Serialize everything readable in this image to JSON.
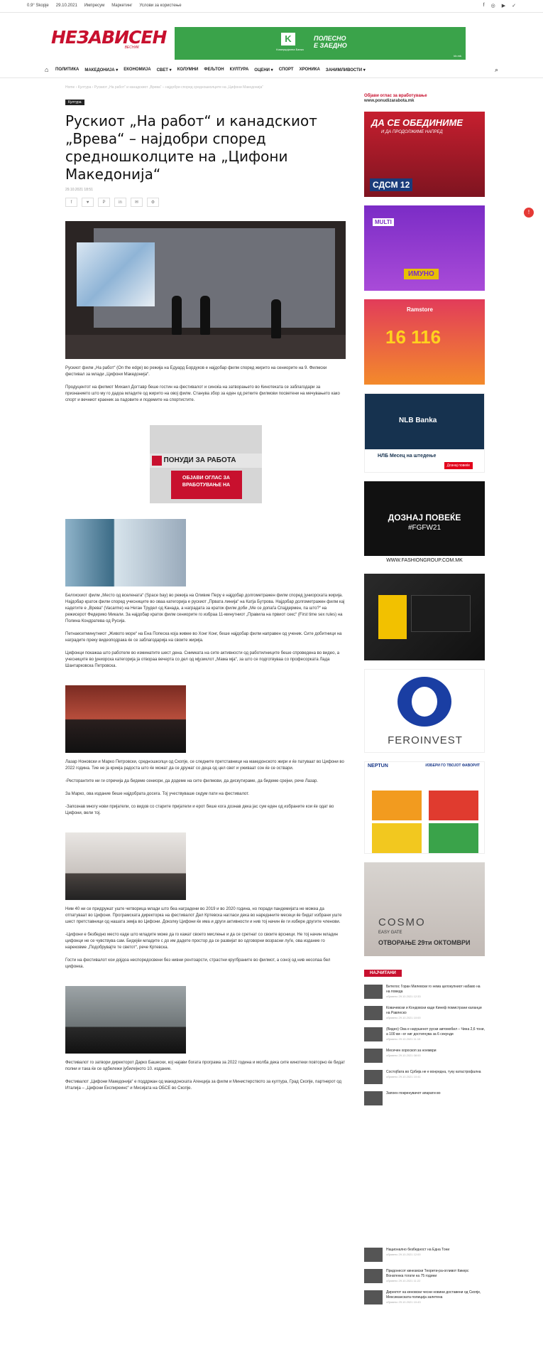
{
  "topbar": {
    "weather": "0.9° Skopje",
    "date": "29.10.2021",
    "links": [
      "Импресум",
      "Маркетинг",
      "Услови за користење"
    ],
    "social": [
      "f",
      "◎",
      "▶",
      "✓"
    ]
  },
  "brand": {
    "name": "НЕЗАВИСЕН",
    "sub": "ВЕСНИК"
  },
  "top_banner": {
    "badge": "K",
    "bank": "Комерцијална Банка",
    "slogan_1": "ПОЛЕСНО",
    "slogan_2": "Е ЗАЕДНО",
    "url": "kb.mk"
  },
  "nav": {
    "home_icon": "⌂",
    "items": [
      "ПОЛИТИКА",
      "МАКЕДОНИЈА ▾",
      "ЕКОНОМИЈА",
      "СВЕТ ▾",
      "КОЛУМНИ",
      "ФЕЉТОН",
      "КУЛТУРА",
      "ОЦЕНИ ▾",
      "СПОРТ",
      "ХРОНИКА",
      "ЗАНИМЛИВОСТИ ▾"
    ],
    "search_icon": "⌕"
  },
  "breadcrumb": "Home › Култура › Рускиот „На работ“ и канадскиот „Врева“ – најдобри според средношколците на „Цифони Македонија“",
  "article": {
    "category": "Култура",
    "title": "Рускиот „На работ“ и канадскиот „Врева“ – најдобри според средношколците на „Цифони Македонија“",
    "date": "29.10.2021 18:51",
    "share": [
      "f",
      "♥",
      "P",
      "in",
      "✉",
      "⚙"
    ],
    "p1": "Рускиот филм „На работ“ (On the edge) во режија на Едуард Бордуков е најдобар филм според жирито на сениорите на 9. Филмски фестивал за млади „Цифони Македонија“.",
    "p2": "Продуцентот на филмот Михаил Догтавр беше гостин на фестивалот и синоќа на затворањето во Кинотеката се заблагодари за признанието што му го дадоа младите од жирито на овој филм. Станува збор за еден од ретките филмови посветени на мечувањето како спорт и вечниот краеник за падовите и подемите на спортистите.",
    "ad": {
      "header": "ПОНУДИ ЗА РАБОТА",
      "cta": "ОБЈАВИ ОГЛАС ЗА ВРАБОТУВАЊЕ НА"
    },
    "p3": "Белгискиот филм „Место од вселената“ (Space bay) во режија на Оливие Перу е најдобар долгометражен филм според јуниорската жирија. Најдобар краток филм според учесниците во оваа категорија е рускиот „Првата линија“ на Катја Бутрова. Најдобар долгометражен филм кај кадетите е „Врева“ (Vacarme) на Неган Трудел од Канада, а наградата за краток филм доби „Ме се допаѓа Спајдермен, па што?“ на режисерот Федерико Микали. За најдобар краток филм сениорите го избраа 11-минутниот „Правила на првиот секс“ (First time sex rules) на Полина Кондратева од Русија.",
    "p4": "Петнаесетминутниот „Живото море“ на Ена Попеска која живее во Хонг Конг, беше најдобар филм направен од ученик. Сите добитници на наградите преку видеоподрака ќе се заблагодарија на своите жирија.",
    "p5": "Цифонци покажаа што работеле во изминатите шест дена. Снимката на сите активности од работилниците беше спроведена во видео, а учесниците во јуниорска категорија ја отвораа вечерта со дел од мјузиклот „Мама мја“, за што се подготвуваа со професорката Лада Шантарковска Петровска.",
    "p6": "Лазар Ноновски и Марко Петровски, средношколци од Скопје, се следните претставници на македонското жири и ќе патуваат во Цифони во 2022 година. Тие не ја криеја радоста што ќе можат да се дружат со деца од цел свет и уживаат сон ќе се оствари.",
    "p7": "-Ресторантите ни ги спречија да бидеме сениори, да додеме на сите филмови, да дискутираме, да бидеме срејни, рече Лазар.",
    "p8": "За Марко, ова издание беше најдобрата досега. Тој учествуваше седум пати на фестивалот.",
    "p9": "-Запознав многу нови пријатели, со видов со старите пријатели и ерот беше кога дознав дека јас сум еден од избраните кои ќе одат во Цифони, вели тој.",
    "p10": "Ним 40 ни се придружат уште четворица млади што беа наградени во 2019 и во 2020 година, но поради пандемијата не можеа да отпатуваат во Цифони. Програмската директорка на фестивалот Дел Кртевска нагласи дека во нареднните месеци ќе бидат избрани уште шест претставници од нашата земја во Цифони. Доколку Цифони ќе има и други активности и нив тој начин ќе ги избере другите членови.",
    "p11": "-Цифони е безбедно место каде што младите може да го кажат своето мислење и да се сретнат со своите врсници. Не тој начин младин цифонци не се чувствува сам. Бидејќи младите с до им дадете простор да се развијат во одговорни возрасни луѓе, ова издание го нарековме „Подобрувајте те светот“, рече Кртевска.",
    "p12": "Гости на фестивалот кои дојдоа неспоредосвени без нивни рентоарсти, страстни кругбраните во филмот, а соној од нив несопаа бел цифонка.",
    "p13": "Фестивалот го затвори директорот Дарко Башески, кој најави богата програма за 2022 година и молба дека сите кинотеки повторно ќе бидат полни и така ќе се одбележи јубилејното 10. издание.",
    "p14": "Фестивалот „Цифони Македонија“ е поддржан од македонската Агенција за филм и Министерството за култура, Град Скопје, партнерот од Италија – „Цифони Експиреинс“ и Мисијата на ОБСЕ во Скопје."
  },
  "sidebar": {
    "ad_label_1": "Објави оглас за вработување",
    "ad_label_2": "www.ponudizarabota.mk",
    "ads": {
      "sdsm_title": "ДА СЕ ОБЕДИНИМЕ",
      "sdsm_sub": "И ДА ПРОДОЛЖИМЕ НАПРЕД",
      "sdsm_logo": "СДСМ 12",
      "multi": "MULTI",
      "imuno": "ИМУНО",
      "ramstore": "Ramstore",
      "ramstore_num": "16 116",
      "nlb": "NLB Banka",
      "nlb_month": "НЛБ Месец на штедење",
      "nlb_btn": "Дознај повеќе",
      "fgfw_1": "ДОЗНАЈ ПОВЕЌЕ",
      "fgfw_2": "#FGFW21",
      "fgfw_url": "WWW.FASHIONGROUP.COM.MK",
      "feroinvest": "FEROINVEST",
      "neptun": "NEPTUN",
      "neptun_tag": "ИЗБЕРИ ГО ТВОЈОТ ФАВОРИТ",
      "cosmo": "COSMO",
      "cosmo_sub": "EASY GATE",
      "cosmo_date": "ОТВОРАЊЕ 29ти ОКТОМВРИ"
    },
    "most_read_label": "НАЈЧИТАНИ",
    "most_read": [
      {
        "title": "Бителос Горан Милевски го нема целокупниот набаво на на поведа",
        "time": "објавено 29.10.2021 12:33"
      },
      {
        "title": "Ковачевски и Кондовски каде Кинеф помистрани каланџи на Равлеско",
        "time": "објавено 29.10.2021 10:00"
      },
      {
        "title": "(Видео) Ова е нарушенот руски автомобил – Чина 2,6 тони, а 100 км –ог ниг достигнува за 6 секунди",
        "time": "објавено 29.10.2021 11:15"
      },
      {
        "title": "Месечен хороскоп за ноември",
        "time": "објавено 29.10.2021 08:00"
      },
      {
        "title": "Состојбата во Србија не е вонредна, туку катастрофална",
        "time": "објавено 29.10.2021 10:41"
      },
      {
        "title": "Запоен покренувачот апарати во",
        "time": ""
      }
    ],
    "bottom_news": [
      {
        "title": "Национално безбедност на Една Тони",
        "time": "објавено 29.10.2021 12:00"
      },
      {
        "title": "Придонесот кинезиски Теорети-ра-огливот Кикерс Вонатенка тогати на 75 години",
        "time": "објавено 29.10.2021 11:22"
      },
      {
        "title": "Директот на кеновски чесни новини доставени од Скопје, Мексиканската полиција залетена",
        "time": "објавено 29.10.2021 10:43"
      }
    ]
  },
  "notify": "!"
}
